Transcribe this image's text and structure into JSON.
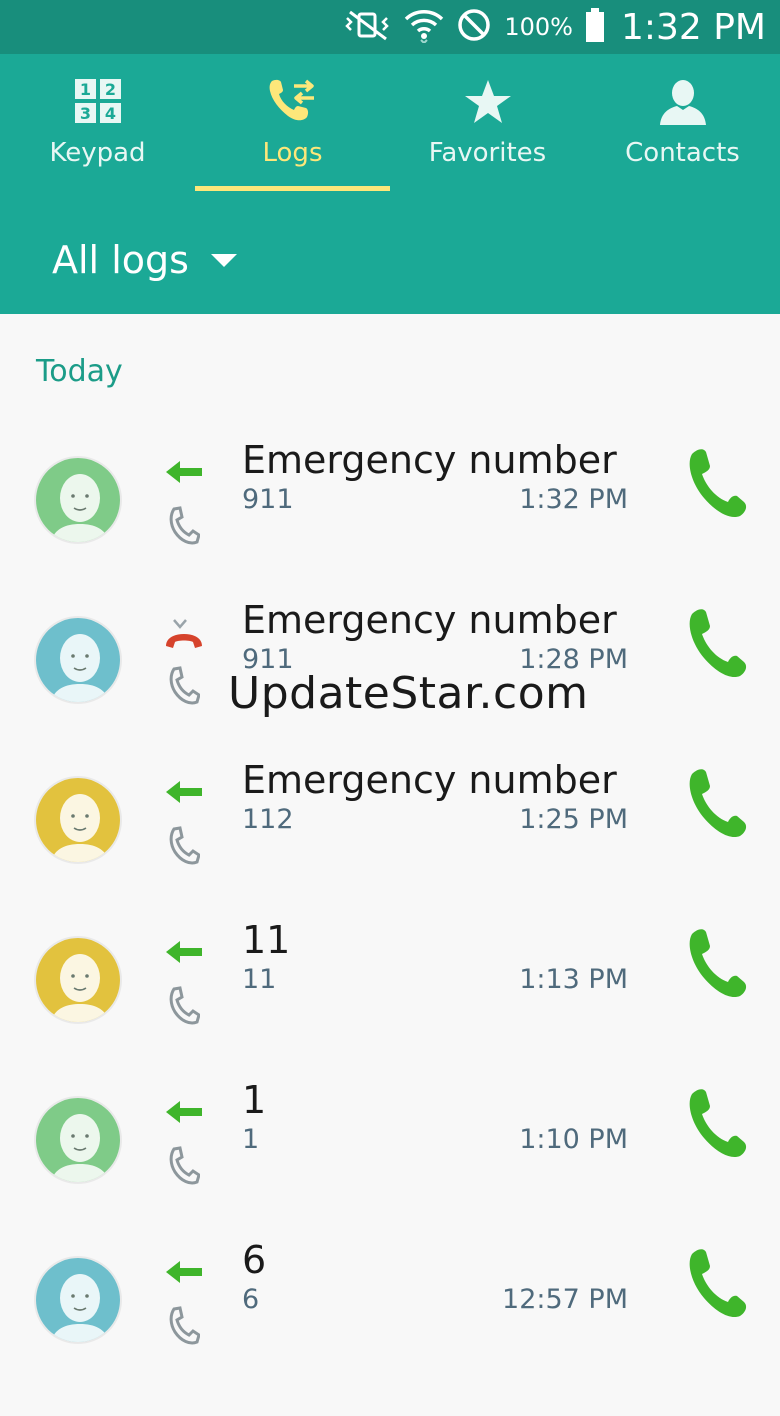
{
  "status_bar": {
    "battery_percent": "100%",
    "time": "1:32 PM",
    "icons": [
      "vibrate-mute-icon",
      "wifi-icon",
      "do-not-disturb-icon",
      "battery-icon"
    ]
  },
  "tabs": [
    {
      "label": "Keypad",
      "icon": "keypad-icon",
      "active": false
    },
    {
      "label": "Logs",
      "icon": "call-logs-icon",
      "active": true
    },
    {
      "label": "Favorites",
      "icon": "star-icon",
      "active": false
    },
    {
      "label": "Contacts",
      "icon": "person-icon",
      "active": false
    }
  ],
  "filter": {
    "label": "All logs",
    "icon": "dropdown-caret-icon"
  },
  "section": {
    "title": "Today"
  },
  "logs": [
    {
      "name": "Emergency number",
      "number": "911",
      "time": "1:32 PM",
      "direction": "outgoing",
      "avatar_color": "#7fcb88"
    },
    {
      "name": "Emergency number",
      "number": "911",
      "time": "1:28 PM",
      "direction": "rejected",
      "avatar_color": "#6ebfcc"
    },
    {
      "name": "Emergency number",
      "number": "112",
      "time": "1:25 PM",
      "direction": "outgoing",
      "avatar_color": "#e2c23e"
    },
    {
      "name": "11",
      "number": "11",
      "time": "1:13 PM",
      "direction": "outgoing",
      "avatar_color": "#e2c23e"
    },
    {
      "name": "1",
      "number": "1",
      "time": "1:10 PM",
      "direction": "outgoing",
      "avatar_color": "#7fcb88"
    },
    {
      "name": "6",
      "number": "6",
      "time": "12:57 PM",
      "direction": "outgoing",
      "avatar_color": "#6ebfcc"
    }
  ],
  "watermark": "UpdateStar.com",
  "colors": {
    "header": "#1ba996",
    "status_bar": "#188e7c",
    "accent_yellow": "#fde77a",
    "call_green": "#3fb52b",
    "rejected_red": "#d6432c",
    "section_teal": "#1b9c88"
  }
}
